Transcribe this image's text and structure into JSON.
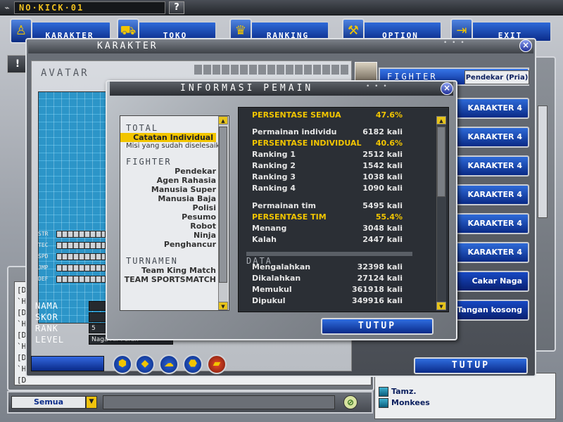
{
  "top_bar": {
    "title": "NO·KICK·01",
    "help_label": "?"
  },
  "menu": {
    "items": [
      {
        "label": "KARAKTER"
      },
      {
        "label": "TOKO"
      },
      {
        "label": "RANKING"
      },
      {
        "label": "OPTION"
      },
      {
        "label": "EXIT"
      }
    ]
  },
  "karakter_window": {
    "title": "KARAKTER",
    "avatar_label": "AVATAR",
    "stats": [
      "STR",
      "TEC",
      "SPD",
      "JMP",
      "DEF"
    ],
    "info": {
      "nama_label": "NAMA",
      "skor_label": "SKOR",
      "rank_label": "RANK",
      "level_label": "LEVEL",
      "level_value": "Naga Air Perak",
      "rank_value": "5"
    },
    "fighter_title": "FIGHTER",
    "fighter_sub": "Pendekar (Pria)",
    "slots": [
      "KARAKTER 4",
      "KARAKTER 4",
      "KARAKTER 4",
      "KARAKTER 4",
      "KARAKTER 4",
      "KARAKTER 4"
    ],
    "special_slots": [
      "Cakar Naga",
      "Tangan kosong"
    ],
    "tutup_label": "TUTUP"
  },
  "informasi_pemain": {
    "title": "INFORMASI PEMAIN",
    "categories": {
      "total_head": "TOTAL",
      "total_items": [
        "Catatan Individual"
      ],
      "total_note": "Misi yang sudah diselesaikan",
      "fighter_head": "FIGHTER",
      "fighter_items": [
        "Pendekar",
        "Agen Rahasia",
        "Manusia Super",
        "Manusia Baja",
        "Polisi",
        "Pesumo",
        "Robot",
        "Ninja",
        "Penghancur"
      ],
      "turnamen_head": "TURNAMEN",
      "turnamen_items": [
        "Team King Match",
        "TEAM SPORTSMATCH"
      ]
    },
    "stats": {
      "persentase_semua": {
        "label": "PERSENTASE SEMUA",
        "value": "47.6%"
      },
      "permainan_individu": {
        "label": "Permainan individu",
        "value": "6182 kali"
      },
      "persentase_individual": {
        "label": "PERSENTASE INDIVIDUAL",
        "value": "40.6%"
      },
      "ranking1": {
        "label": "Ranking 1",
        "value": "2512 kali"
      },
      "ranking2": {
        "label": "Ranking 2",
        "value": "1542 kali"
      },
      "ranking3": {
        "label": "Ranking 3",
        "value": "1038 kali"
      },
      "ranking4": {
        "label": "Ranking 4",
        "value": "1090 kali"
      },
      "permainan_tim": {
        "label": "Permainan tim",
        "value": "5495 kali"
      },
      "persentase_tim": {
        "label": "PERSENTASE TIM",
        "value": "55.4%"
      },
      "menang": {
        "label": "Menang",
        "value": "3048 kali"
      },
      "kalah": {
        "label": "Kalah",
        "value": "2447 kali"
      },
      "data_head": "DATA",
      "mengalahkan": {
        "label": "Mengalahkan",
        "value": "32398 kali"
      },
      "dikalahkan": {
        "label": "Dikalahkan",
        "value": "27124 kali"
      },
      "memukul": {
        "label": "Memukul",
        "value": "361918 kali"
      },
      "dipukul": {
        "label": "Dipukul",
        "value": "349916 kali"
      }
    },
    "tutup_label": "TUTUP"
  },
  "chat": {
    "lines": [
      "[D",
      "`H",
      "[D",
      "`H",
      "[D",
      "`H",
      "[D",
      "`H",
      "[D"
    ],
    "filter_value": "Semua"
  },
  "users": {
    "items": [
      "Tamz.",
      "Monkees"
    ]
  },
  "colors": {
    "accent_blue": "#0b2c8a",
    "highlight_yellow": "#f2c500"
  }
}
